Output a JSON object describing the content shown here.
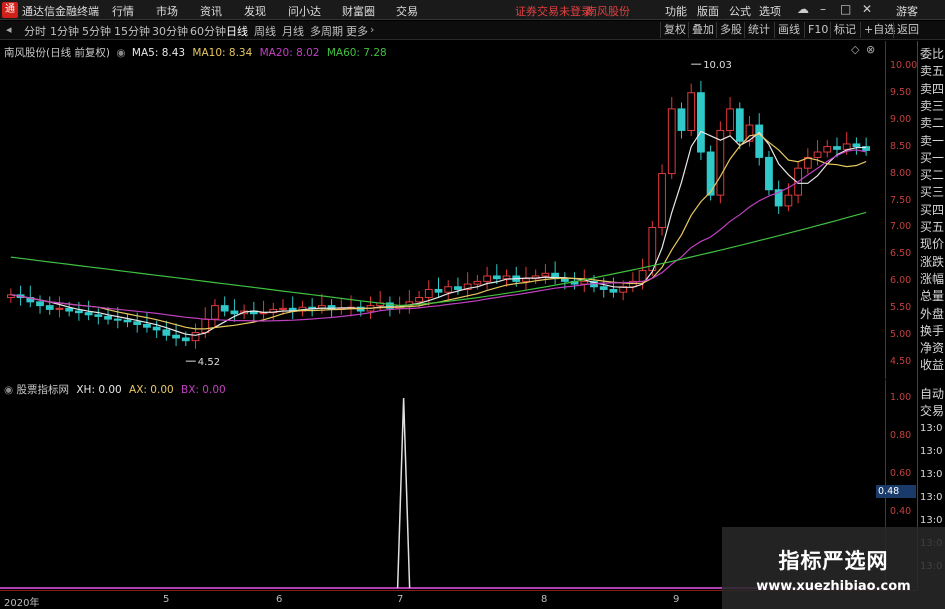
{
  "app": {
    "title": "通达信金融终端",
    "notice": "证券交易未登录",
    "stock_name": "南风股份"
  },
  "menu": [
    "行情",
    "市场",
    "资讯",
    "发现",
    "问小达",
    "财富圈",
    "交易"
  ],
  "top_right": [
    "功能",
    "版面",
    "公式",
    "选项",
    "游客"
  ],
  "periods": [
    "分时",
    "1分钟",
    "5分钟",
    "15分钟",
    "30分钟",
    "60分钟",
    "日线",
    "周线",
    "月线",
    "多周期",
    "更多"
  ],
  "active_period": "日线",
  "tools": [
    "复权",
    "叠加",
    "多股",
    "统计",
    "画线",
    "F10",
    "标记",
    "+自选",
    "返回"
  ],
  "main_legend": {
    "title": "南风股份(日线 前复权)",
    "ma5": "MA5: 8.43",
    "ma10": "MA10: 8.34",
    "ma20": "MA20: 8.02",
    "ma60": "MA60: 7.28"
  },
  "sub_legend": {
    "title": "股票指标网",
    "xh": "XH: 0.00",
    "ax": "AX: 0.00",
    "bx": "BX: 0.00"
  },
  "annotations": {
    "high": "10.03",
    "low": "4.52"
  },
  "y_ticks_main": [
    "10.00",
    "9.50",
    "9.00",
    "8.50",
    "8.00",
    "7.50",
    "7.00",
    "6.50",
    "6.00",
    "5.50",
    "5.00",
    "4.50"
  ],
  "y_ticks_sub": [
    "1.00",
    "0.80",
    "0.60",
    "0.40"
  ],
  "value_flag": "0.48",
  "date_ticks": [
    "2020年",
    "5",
    "6",
    "7",
    "8",
    "9"
  ],
  "right_panel": [
    "委比",
    "卖五",
    "卖四",
    "卖三",
    "卖二",
    "卖一",
    "买一",
    "买二",
    "买三",
    "买四",
    "买五",
    "现价",
    "涨跌",
    "涨幅",
    "总量",
    "外盘",
    "换手",
    "净资",
    "收益",
    "自动",
    "交易"
  ],
  "right_times": [
    "13:0",
    "13:0",
    "13:0",
    "13:0",
    "13:0",
    "13:0",
    "13:0"
  ],
  "watermark": {
    "title": "指标严选网",
    "url": "www.xuezhibiao.com"
  },
  "colors": {
    "up": "#e03a3a",
    "down": "#30c8c8",
    "ma5": "#e8e8e8",
    "ma10": "#e8c860",
    "ma20": "#c040c0",
    "ma60": "#40c040",
    "sub_line": "#e0e0e0"
  },
  "chart_data": {
    "type": "candlestick",
    "ylim": [
      4.3,
      10.2
    ],
    "closes": [
      5.75,
      5.7,
      5.62,
      5.55,
      5.48,
      5.5,
      5.45,
      5.42,
      5.38,
      5.35,
      5.3,
      5.28,
      5.25,
      5.2,
      5.15,
      5.1,
      5.0,
      4.95,
      4.9,
      5.05,
      5.3,
      5.55,
      5.45,
      5.4,
      5.45,
      5.4,
      5.42,
      5.48,
      5.5,
      5.45,
      5.52,
      5.5,
      5.55,
      5.48,
      5.5,
      5.52,
      5.45,
      5.55,
      5.6,
      5.5,
      5.55,
      5.62,
      5.7,
      5.85,
      5.8,
      5.9,
      5.85,
      5.95,
      6.0,
      6.1,
      6.05,
      6.1,
      6.0,
      6.05,
      6.1,
      6.15,
      6.05,
      6.0,
      5.95,
      6.0,
      5.9,
      5.85,
      5.8,
      5.9,
      6.0,
      6.2,
      7.0,
      8.0,
      9.2,
      8.8,
      9.5,
      8.4,
      7.6,
      8.8,
      9.2,
      8.6,
      8.9,
      8.3,
      7.7,
      7.4,
      7.6,
      8.1,
      8.3,
      8.4,
      8.5,
      8.45,
      8.55,
      8.5,
      8.43
    ],
    "ma60_start": 6.45,
    "ma60_end": 7.28,
    "sub_spike_index": 40,
    "sub_spike_value": 1.0
  }
}
